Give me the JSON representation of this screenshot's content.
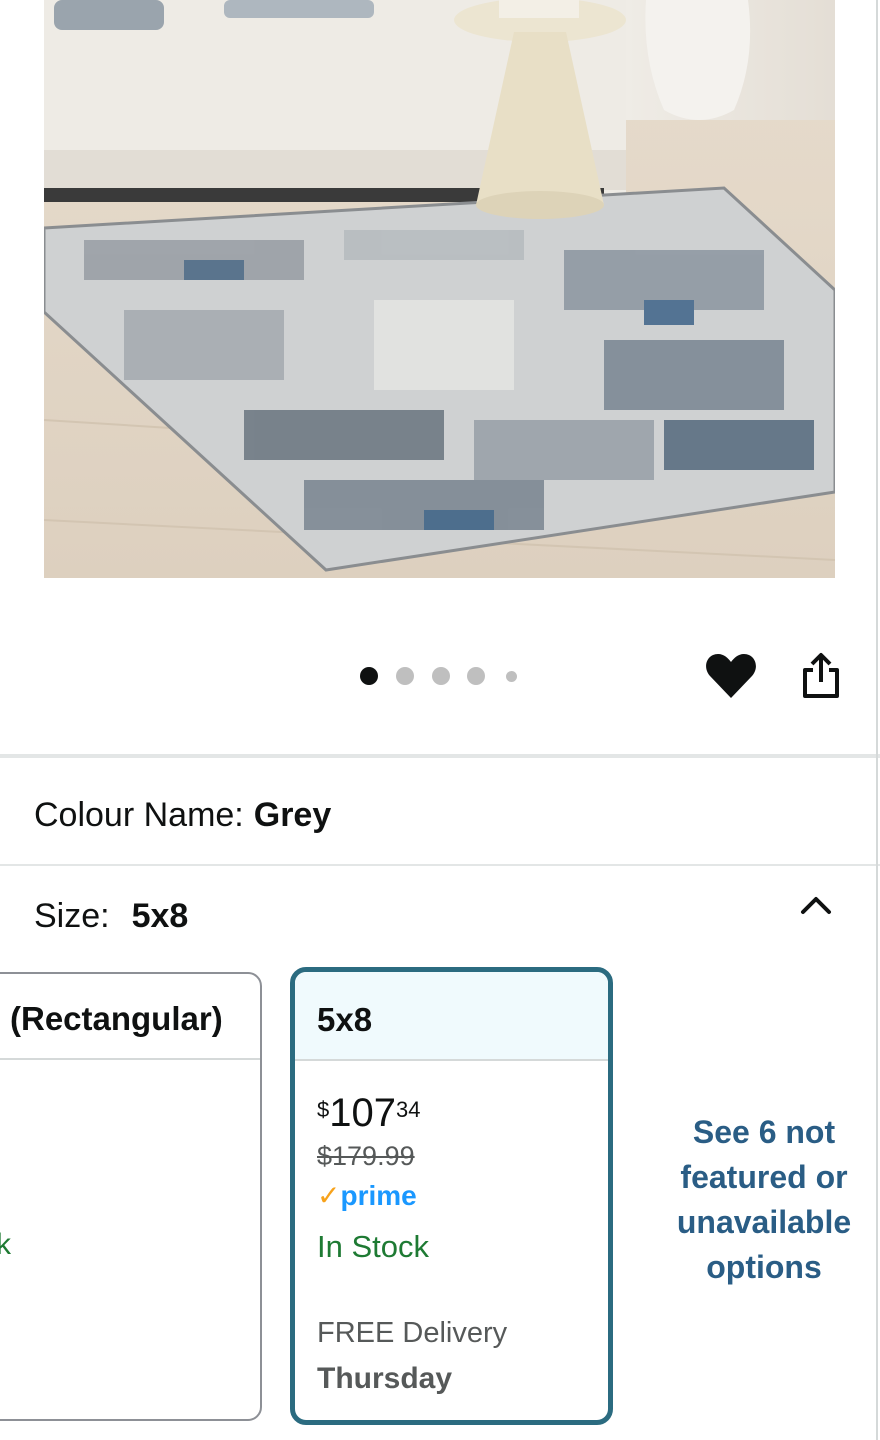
{
  "product_image": {
    "alt": "Grey abstract area rug in living room",
    "active_index": 0,
    "count": 5
  },
  "actions": {
    "wishlist_icon": "heart-icon",
    "share_icon": "share-icon"
  },
  "colour": {
    "label": "Colour Name:",
    "value": "Grey"
  },
  "size": {
    "label": "Size:",
    "value": "5x8"
  },
  "cards": {
    "previous": {
      "title": "(Rectangular)",
      "stock": "k"
    },
    "selected": {
      "title": "5x8",
      "price_symbol": "$",
      "price_whole": "107",
      "price_fraction": "34",
      "was_price": "$179.99",
      "prime_check": "✓",
      "prime_word": "prime",
      "stock": "In Stock",
      "delivery_line1": "FREE Delivery",
      "delivery_line2": "Thursday"
    }
  },
  "see_more": {
    "line1": "See 6 not",
    "line2": "featured or",
    "line3": "unavailable",
    "line4": "options"
  },
  "colors": {
    "accent_border": "#2b6b80",
    "selected_header_bg": "#f0fafd",
    "stock_green": "#1e7a33",
    "link_blue": "#2a5d85",
    "prime_blue": "#1a98ff",
    "prime_orange": "#f7a21b"
  }
}
